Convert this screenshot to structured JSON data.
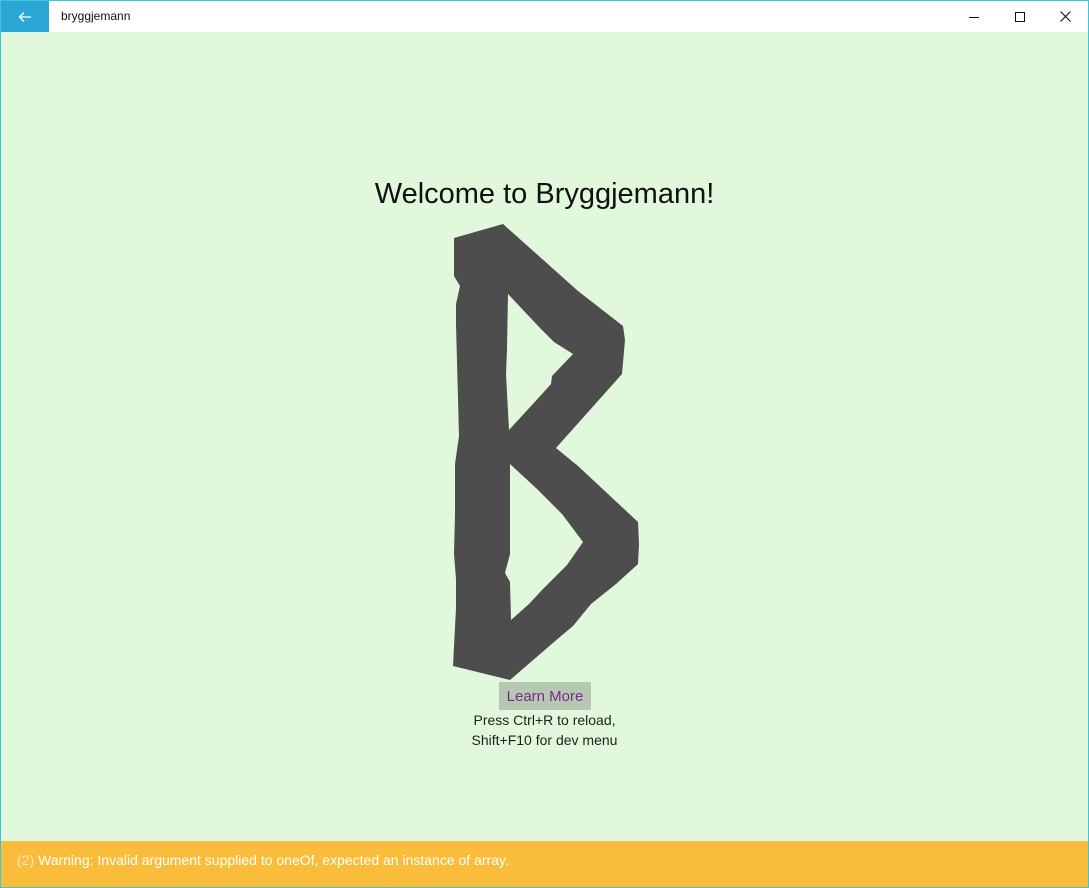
{
  "window": {
    "title": "bryggjemann",
    "back_icon": "arrow-left-icon",
    "minimize_icon": "minimize-icon",
    "maximize_icon": "maximize-icon",
    "close_icon": "close-icon"
  },
  "main": {
    "welcome": "Welcome to Bryggjemann!",
    "logo_icon": "bryggjemann-rune-logo",
    "logo_color": "#4d4d4d",
    "learn_more": "Learn More",
    "hint_line1": "Press Ctrl+R to reload,",
    "hint_line2": "Shift+F10 for dev menu",
    "background_color": "#e2f8dc"
  },
  "warning": {
    "count": "(2)",
    "message": "Warning: Invalid argument supplied to oneOf, expected an instance of array.",
    "color": "#f9bd3b"
  },
  "colors": {
    "accent": "#2aa6d4",
    "button_bg": "#b5c9b2",
    "link_text": "#7a2a8c"
  }
}
